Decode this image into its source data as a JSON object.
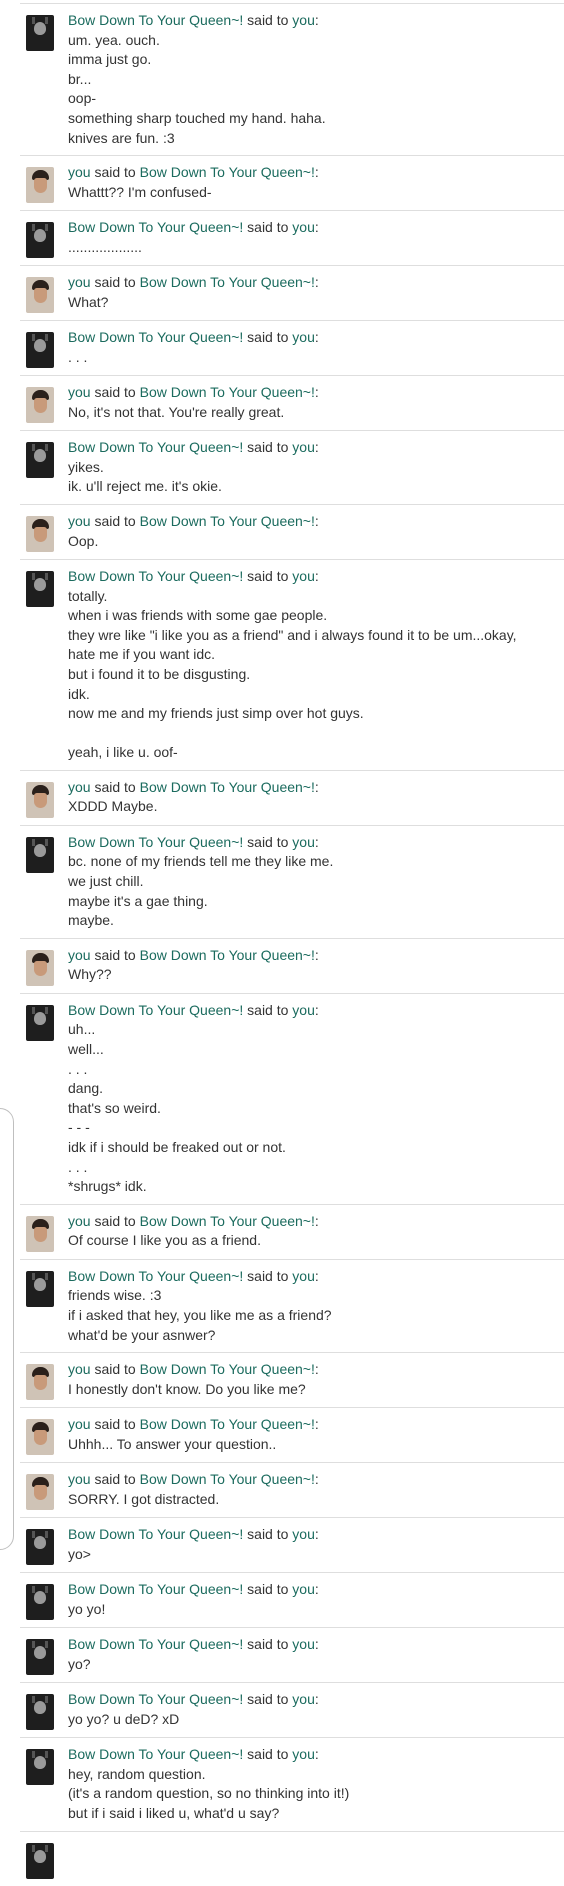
{
  "labels": {
    "said_to": "said to",
    "colon": ":"
  },
  "colors": {
    "name_link": "#1b6b5e",
    "text": "#333333",
    "divider": "#dedede"
  },
  "messages": [
    {
      "from": "Bow Down To Your Queen~!",
      "to": "you",
      "avatar": "queen",
      "lines": [
        "um. yea. ouch.",
        "imma just go.",
        "br...",
        "oop-",
        "something sharp touched my hand. haha.",
        "knives are fun. :3"
      ]
    },
    {
      "from": "you",
      "to": "Bow Down To Your Queen~!",
      "avatar": "you",
      "lines": [
        "Whattt?? I'm confused-"
      ]
    },
    {
      "from": "Bow Down To Your Queen~!",
      "to": "you",
      "avatar": "queen",
      "lines": [
        "..................."
      ]
    },
    {
      "from": "you",
      "to": "Bow Down To Your Queen~!",
      "avatar": "you",
      "lines": [
        "What?"
      ]
    },
    {
      "from": "Bow Down To Your Queen~!",
      "to": "you",
      "avatar": "queen",
      "lines": [
        ". . ."
      ]
    },
    {
      "from": "you",
      "to": "Bow Down To Your Queen~!",
      "avatar": "you",
      "lines": [
        "No, it's not that. You're really great."
      ]
    },
    {
      "from": "Bow Down To Your Queen~!",
      "to": "you",
      "avatar": "queen",
      "lines": [
        "yikes.",
        "ik. u'll reject me. it's okie."
      ]
    },
    {
      "from": "you",
      "to": "Bow Down To Your Queen~!",
      "avatar": "you",
      "lines": [
        "Oop."
      ]
    },
    {
      "from": "Bow Down To Your Queen~!",
      "to": "you",
      "avatar": "queen",
      "lines": [
        "totally.",
        "when i was friends with some gae people.",
        "they wre like \"i like you as a friend\" and i always found it to be um...okay,",
        "hate me if you want idc.",
        "but i found it to be disgusting.",
        "idk.",
        "now me and my friends just simp over hot guys.",
        "",
        "yeah, i like u. oof-"
      ]
    },
    {
      "from": "you",
      "to": "Bow Down To Your Queen~!",
      "avatar": "you",
      "lines": [
        "XDDD Maybe."
      ]
    },
    {
      "from": "Bow Down To Your Queen~!",
      "to": "you",
      "avatar": "queen",
      "lines": [
        "bc. none of my friends tell me they like me.",
        "we just chill.",
        "maybe it's a gae thing.",
        "maybe."
      ]
    },
    {
      "from": "you",
      "to": "Bow Down To Your Queen~!",
      "avatar": "you",
      "lines": [
        "Why??"
      ]
    },
    {
      "from": "Bow Down To Your Queen~!",
      "to": "you",
      "avatar": "queen",
      "lines": [
        "uh...",
        "well...",
        ". . .",
        "dang.",
        "that's so weird.",
        "- - -",
        "idk if i should be freaked out or not.",
        ". . .",
        "*shrugs* idk."
      ]
    },
    {
      "from": "you",
      "to": "Bow Down To Your Queen~!",
      "avatar": "you",
      "lines": [
        "Of course I like you as a friend."
      ]
    },
    {
      "from": "Bow Down To Your Queen~!",
      "to": "you",
      "avatar": "queen",
      "lines": [
        "friends wise. :3",
        "if i asked that hey, you like me as a friend?",
        "what'd be your asnwer?"
      ]
    },
    {
      "from": "you",
      "to": "Bow Down To Your Queen~!",
      "avatar": "you",
      "lines": [
        "I honestly don't know. Do you like me?"
      ]
    },
    {
      "from": "you",
      "to": "Bow Down To Your Queen~!",
      "avatar": "you",
      "lines": [
        "Uhhh... To answer your question.."
      ]
    },
    {
      "from": "you",
      "to": "Bow Down To Your Queen~!",
      "avatar": "you",
      "lines": [
        "SORRY. I got distracted."
      ]
    },
    {
      "from": "Bow Down To Your Queen~!",
      "to": "you",
      "avatar": "queen",
      "lines": [
        "yo>"
      ]
    },
    {
      "from": "Bow Down To Your Queen~!",
      "to": "you",
      "avatar": "queen",
      "lines": [
        "yo yo!"
      ]
    },
    {
      "from": "Bow Down To Your Queen~!",
      "to": "you",
      "avatar": "queen",
      "lines": [
        "yo?"
      ]
    },
    {
      "from": "Bow Down To Your Queen~!",
      "to": "you",
      "avatar": "queen",
      "lines": [
        "yo yo? u deD? xD"
      ]
    },
    {
      "from": "Bow Down To Your Queen~!",
      "to": "you",
      "avatar": "queen",
      "lines": [
        "hey, random question.",
        "(it's a random question, so no thinking into it!)",
        "but if i said i liked u, what'd u say?"
      ]
    },
    {
      "from": "",
      "to": "",
      "avatar": "queen",
      "lines": []
    }
  ]
}
